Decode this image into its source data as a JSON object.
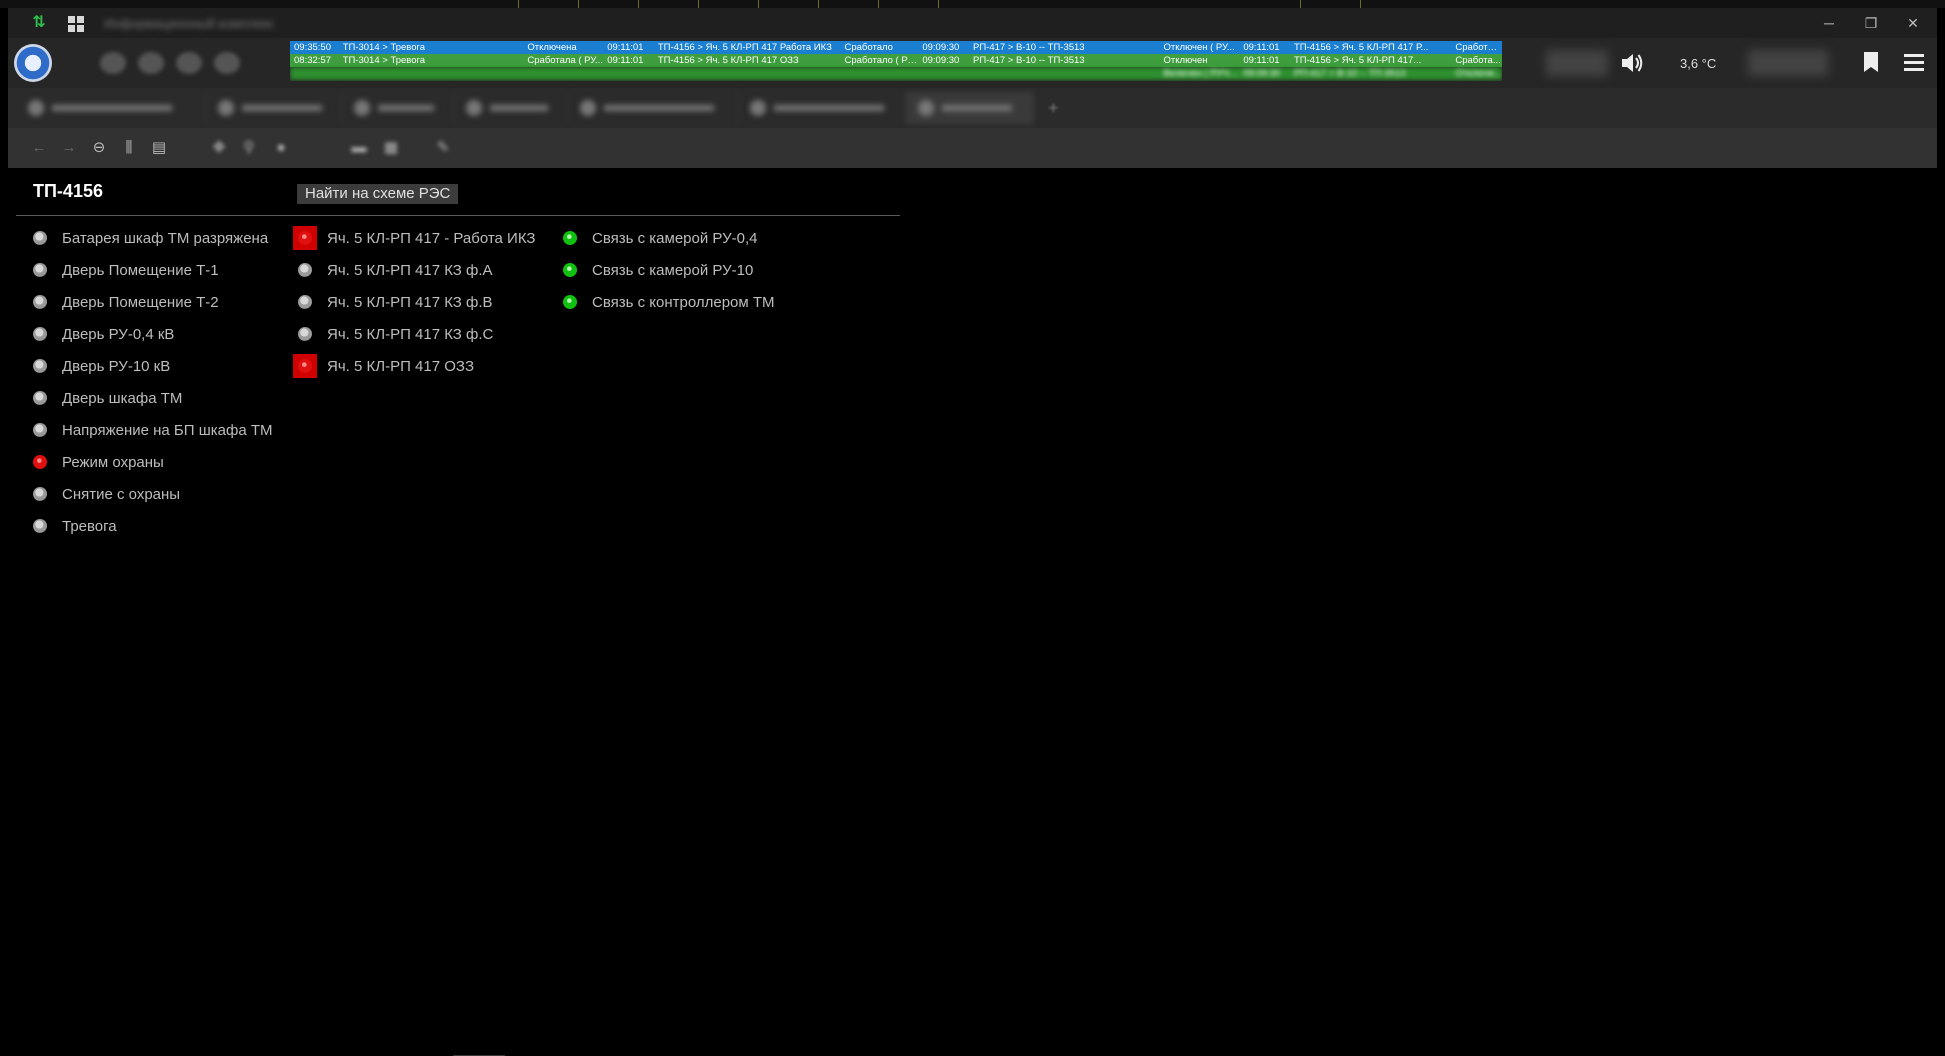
{
  "window": {
    "title": "Информационный комплекс",
    "controls": {
      "minimize": "─",
      "restore": "❐",
      "close": "✕"
    }
  },
  "header": {
    "temperature": "3,6 °C",
    "events": [
      {
        "style": "blue",
        "cells": [
          "09:35:50",
          "ТП-3014 > Тревога",
          "Отключена",
          "09:11:01",
          "ТП-4156 > Яч. 5 КЛ-РП 417 Работа ИКЗ",
          "Сработало",
          "09:09:30",
          "РП-417 > В-10 -- ТП-3513",
          "Отключен ( РУ...",
          "09:11:01",
          "ТП-4156 > Яч. 5 КЛ-РП 417 Р...",
          "Сработало"
        ]
      },
      {
        "style": "green",
        "cells": [
          "08:32:57",
          "ТП-3014 > Тревога",
          "Сработала ( РУ...",
          "09:11:01",
          "ТП-4156 > Яч. 5 КЛ-РП 417 ОЗЗ",
          "Сработало ( РУ...",
          "09:09:30",
          "РП-417 > В-10 -- ТП-3513",
          "Отключен",
          "09:11:01",
          "ТП-4156 > Яч. 5 КЛ-РП 417...",
          "Сработа..."
        ]
      },
      {
        "style": "green2",
        "cells": [
          "",
          "",
          "",
          "",
          "",
          "",
          "",
          "",
          "Включен ( РУЧН )",
          "09:09:30",
          "РП-417 > В-10 -- ТП-3513",
          "Отключе..."
        ]
      }
    ]
  },
  "content": {
    "station_title": "ТП-4156",
    "find_button": "Найти на схеме РЭС",
    "columns": [
      [
        {
          "label": "Батарея шкаф ТМ разряжена",
          "state": "gray"
        },
        {
          "label": "Дверь Помещение Т-1",
          "state": "gray"
        },
        {
          "label": "Дверь Помещение Т-2",
          "state": "gray"
        },
        {
          "label": "Дверь РУ-0,4 кВ",
          "state": "gray"
        },
        {
          "label": "Дверь РУ-10 кВ",
          "state": "gray"
        },
        {
          "label": "Дверь шкафа ТМ",
          "state": "gray"
        },
        {
          "label": "Напряжение на БП шкафа ТМ",
          "state": "gray"
        },
        {
          "label": "Режим охраны",
          "state": "red"
        },
        {
          "label": "Снятие с охраны",
          "state": "gray"
        },
        {
          "label": "Тревога",
          "state": "gray"
        }
      ],
      [
        {
          "label": "Яч. 5 КЛ-РП 417 - Работа ИКЗ",
          "state": "red-alarm"
        },
        {
          "label": "Яч. 5 КЛ-РП 417 КЗ ф.А",
          "state": "gray"
        },
        {
          "label": "Яч. 5 КЛ-РП 417 КЗ ф.В",
          "state": "gray"
        },
        {
          "label": "Яч. 5 КЛ-РП 417 КЗ ф.С",
          "state": "gray"
        },
        {
          "label": "Яч. 5 КЛ-РП 417 ОЗЗ",
          "state": "red-alarm"
        }
      ],
      [
        {
          "label": "Связь с камерой РУ-0,4",
          "state": "green"
        },
        {
          "label": "Связь с камерой РУ-10",
          "state": "green"
        },
        {
          "label": "Связь с контроллером ТМ",
          "state": "green"
        }
      ]
    ]
  },
  "colors": {
    "event_blue": "#1a7fd0",
    "event_green": "#3f9f3f",
    "alarm_red": "#d00000",
    "ok_green": "#12c012"
  }
}
